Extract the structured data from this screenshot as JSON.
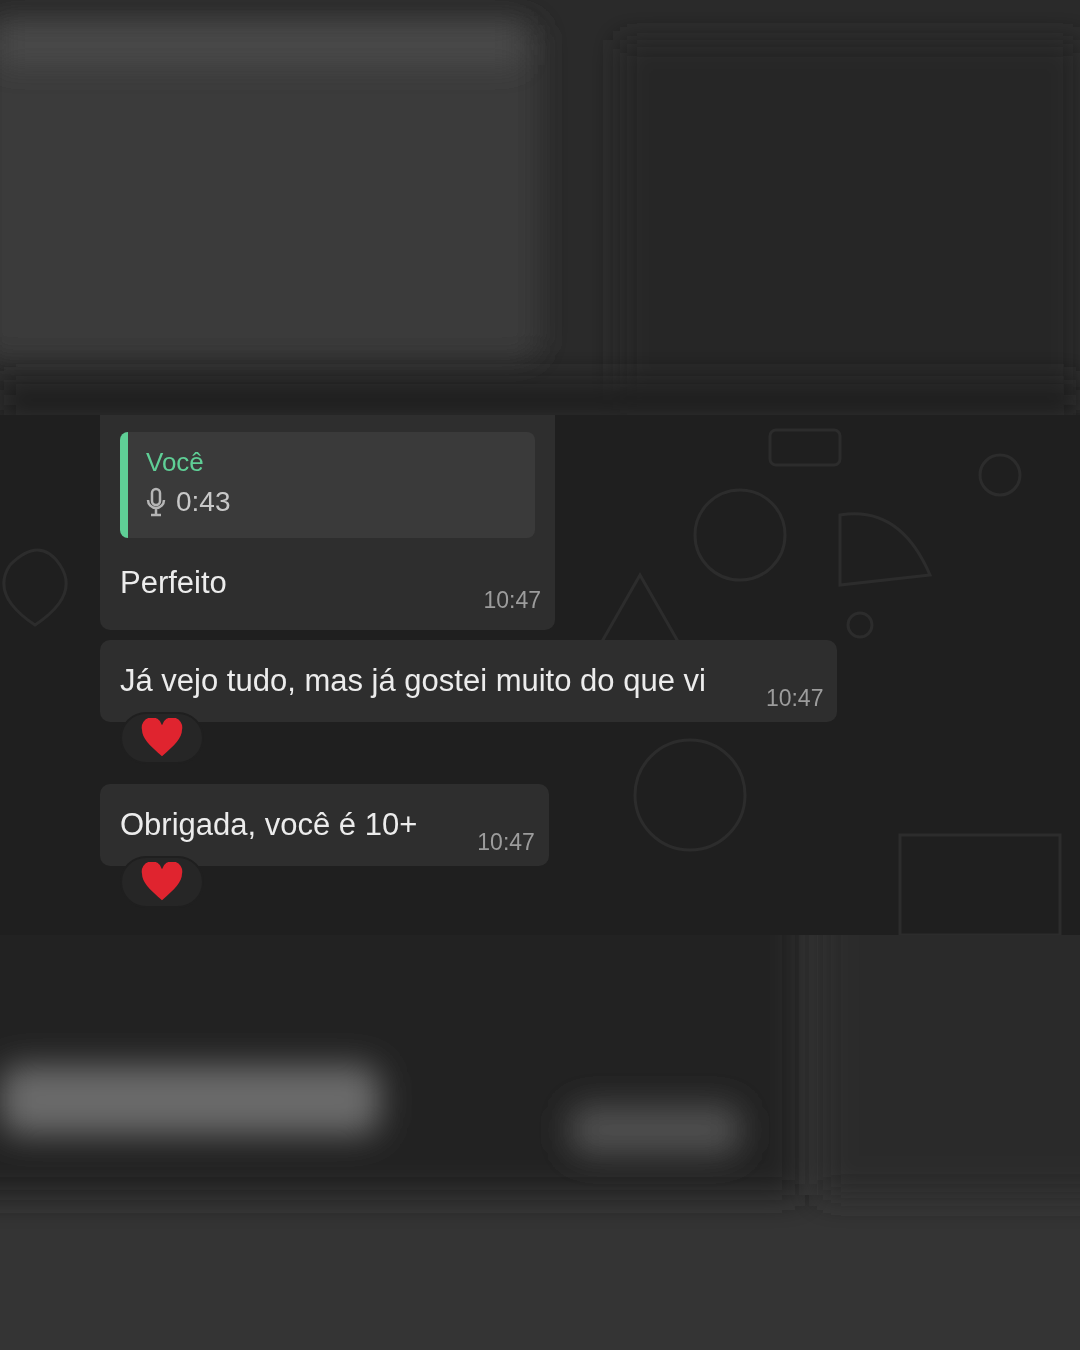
{
  "messages": [
    {
      "kind": "reply",
      "quote": {
        "author": "Você",
        "duration": "0:43"
      },
      "text": "Perfeito",
      "time": "10:47",
      "reaction": false
    },
    {
      "kind": "text",
      "text": "Já vejo tudo, mas já gostei muito do que vi",
      "time": "10:47",
      "reaction": true
    },
    {
      "kind": "text",
      "text": "Obrigada, você é 10+",
      "time": "10:47",
      "reaction": true
    }
  ]
}
